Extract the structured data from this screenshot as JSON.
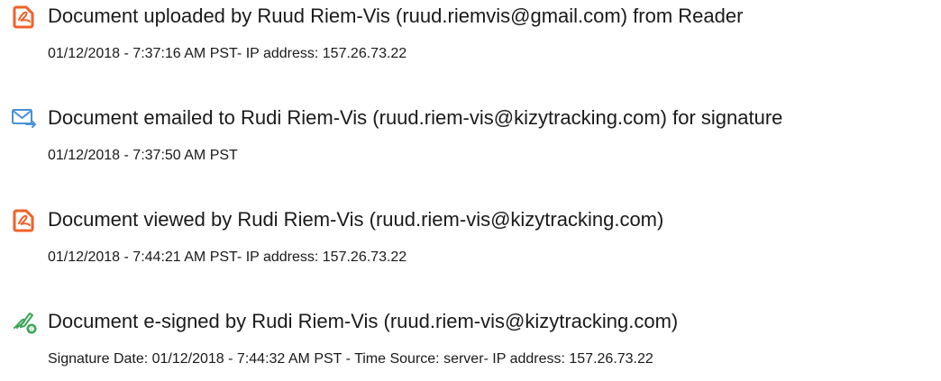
{
  "events": [
    {
      "icon": "document-upload-icon",
      "title": "Document uploaded by Ruud Riem-Vis (ruud.riemvis@gmail.com) from Reader",
      "meta": "01/12/2018 - 7:37:16 AM PST- IP address: 157.26.73.22"
    },
    {
      "icon": "email-sent-icon",
      "title": "Document emailed to Rudi Riem-Vis (ruud.riem-vis@kizytracking.com) for signature",
      "meta": "01/12/2018 - 7:37:50 AM PST"
    },
    {
      "icon": "document-viewed-icon",
      "title": "Document viewed by Rudi Riem-Vis (ruud.riem-vis@kizytracking.com)",
      "meta": "01/12/2018 - 7:44:21 AM PST- IP address: 157.26.73.22"
    },
    {
      "icon": "e-sign-pen-icon",
      "title": "Document e-signed by Rudi Riem-Vis (ruud.riem-vis@kizytracking.com)",
      "meta": "Signature Date: 01/12/2018 - 7:44:32 AM PST - Time Source: server- IP address: 157.26.73.22"
    }
  ],
  "colors": {
    "acrobat_orange": "#f0612a",
    "email_blue": "#4a90d9",
    "sign_green": "#3aa657",
    "text": "#1a1a1a"
  }
}
